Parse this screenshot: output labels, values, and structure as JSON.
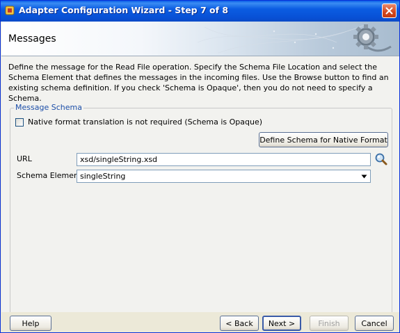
{
  "window": {
    "title": "Adapter Configuration Wizard - Step 7 of 8"
  },
  "header": {
    "title": "Messages"
  },
  "description": "Define the message for the Read File operation.  Specify the Schema File Location and select the Schema Element that defines the messages in the incoming files. Use the Browse button to find an existing schema definition. If you check 'Schema is Opaque', then you do not need to specify a Schema.",
  "message_schema": {
    "group_label": "Message Schema",
    "opaque_checkbox": {
      "label": "Native format translation is not required (Schema is Opaque)",
      "checked": false
    },
    "define_button": "Define Schema for Native Format",
    "url": {
      "label": "URL",
      "value": "xsd/singleString.xsd"
    },
    "schema_element": {
      "label": "Schema Element",
      "value": "singleString"
    }
  },
  "footer": {
    "help": "Help",
    "back": "< Back",
    "next": "Next >",
    "finish": "Finish",
    "cancel": "Cancel"
  },
  "colors": {
    "title_bar": "#0a5ee8",
    "group_label": "#1c4ea8",
    "close_button": "#d2461e"
  }
}
